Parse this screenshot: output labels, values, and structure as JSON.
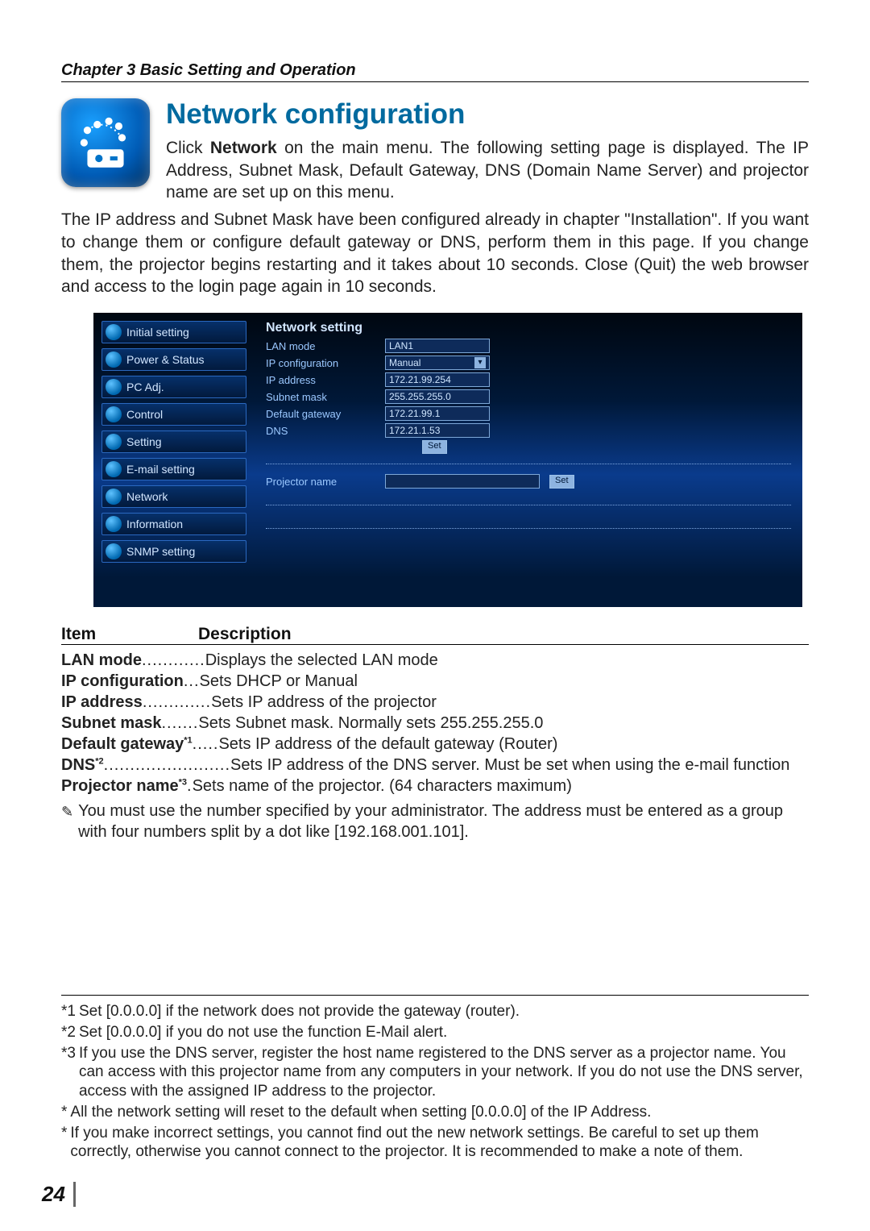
{
  "chapter": "Chapter 3 Basic Setting and Operation",
  "heading": "Network configuration",
  "intro_right": "Click <b>Network</b> on the main menu. The following setting page is displayed. The IP Address, Subnet Mask, Default Gateway, DNS (Domain Name Server) and projector name are set up on this menu.",
  "intro_wide": "The IP address and Subnet Mask have been configured already in chapter \"Installation\". If you want to change them or configure default gateway or DNS, perform them in this page. If you change them, the projector begins restarting and it takes about 10 seconds. Close (Quit) the web browser and access to the login page again in 10 seconds.",
  "screenshot": {
    "menu_items": [
      "Initial setting",
      "Power & Status",
      "PC Adj.",
      "Control",
      "Setting",
      "E-mail setting",
      "Network",
      "Information",
      "SNMP setting"
    ],
    "panel_title": "Network setting",
    "lan_mode_label": "LAN mode",
    "lan_mode_value": "LAN1",
    "ipconf_label": "IP configuration",
    "ipconf_value": "Manual",
    "ipaddr_label": "IP address",
    "ipaddr_value": "172.21.99.254",
    "subnet_label": "Subnet mask",
    "subnet_value": "255.255.255.0",
    "gateway_label": "Default gateway",
    "gateway_value": "172.21.99.1",
    "dns_label": "DNS",
    "dns_value": "172.21.1.53",
    "set_btn": "Set",
    "projector_name_label": "Projector name",
    "projector_name_value": ""
  },
  "desc_head_item": "Item",
  "desc_head_desc": "Description",
  "desc_rows": [
    {
      "item": "LAN mode",
      "sup": "",
      "dots": "............",
      "desc": "Displays the selected LAN mode"
    },
    {
      "item": "IP configuration",
      "sup": "",
      "dots": "...",
      "desc": "Sets DHCP or Manual"
    },
    {
      "item": "IP address",
      "sup": "",
      "dots": ".............",
      "desc": "Sets IP address of the projector"
    },
    {
      "item": "Subnet mask",
      "sup": "",
      "dots": ".......",
      "desc": "Sets Subnet mask. Normally sets 255.255.255.0"
    },
    {
      "item": "Default gateway",
      "sup": "*1",
      "dots": ".....",
      "desc": "Sets IP address of the default gateway (Router)"
    },
    {
      "item": "DNS",
      "sup": "*2",
      "dots": "........................",
      "desc": "Sets IP address of the DNS server. Must be set when using the e-mail function"
    },
    {
      "item": "Projector name",
      "sup": "*3",
      "dots": ".",
      "desc": "Sets name of the projector. (64 characters maximum)"
    }
  ],
  "note_text": "You must use the number specified by your administrator. The address must be entered as a group with four numbers split by a dot like [192.168.001.101].",
  "footnotes": [
    {
      "marker": "*1",
      "text": "Set [0.0.0.0] if the network does not provide the gateway (router)."
    },
    {
      "marker": "*2",
      "text": "Set [0.0.0.0] if you do not use the function E-Mail alert."
    },
    {
      "marker": "*3",
      "text": "If you use the DNS server, register the host name registered to the DNS server as a projector name. You can access with this projector name from any computers in your network. If you do not use the DNS server, access with the assigned IP address to the projector."
    },
    {
      "marker": "*",
      "text": "All the network setting will reset to the default when setting [0.0.0.0] of the IP Address."
    },
    {
      "marker": "*",
      "text": "If you make incorrect settings, you cannot find out the new network settings. Be careful to set up them correctly, otherwise you cannot connect to the projector. It is recommended to make a note of them."
    }
  ],
  "page_number": "24"
}
